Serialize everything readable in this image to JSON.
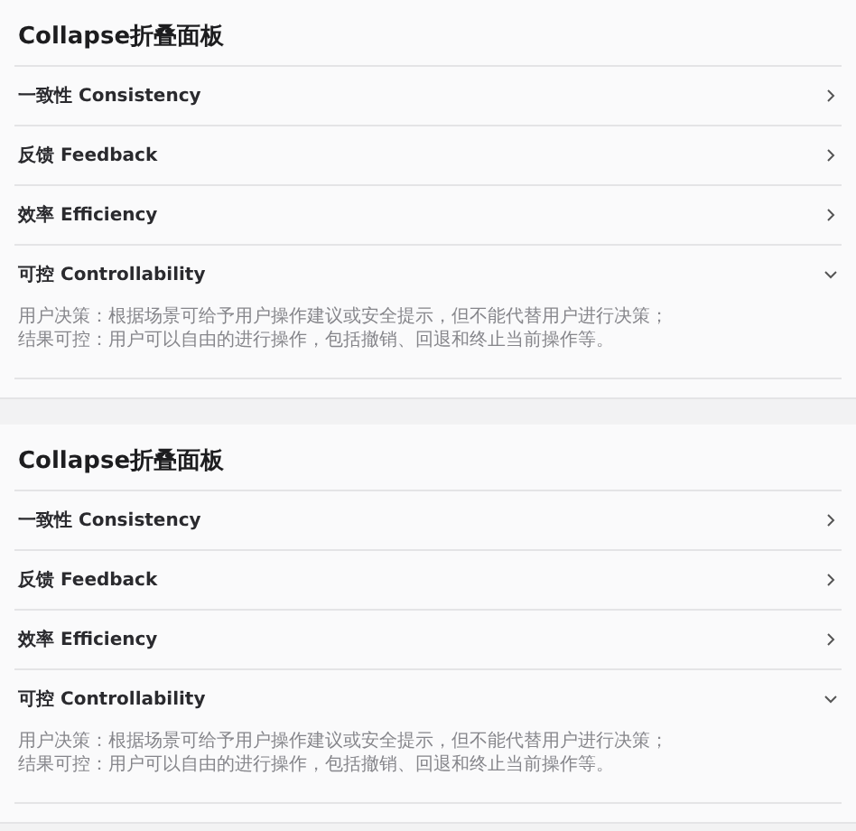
{
  "panels": [
    {
      "title": "Collapse折叠面板",
      "items": [
        {
          "label": "一致性 Consistency",
          "expanded": false
        },
        {
          "label": "反馈 Feedback",
          "expanded": false
        },
        {
          "label": "效率 Efficiency",
          "expanded": false
        },
        {
          "label": "可控 Controllability",
          "expanded": true,
          "content": [
            "用户决策：根据场景可给予用户操作建议或安全提示，但不能代替用户进行决策；",
            "结果可控：用户可以自由的进行操作，包括撤销、回退和终止当前操作等。"
          ]
        }
      ]
    },
    {
      "title": "Collapse折叠面板",
      "items": [
        {
          "label": "一致性 Consistency",
          "expanded": false
        },
        {
          "label": "反馈 Feedback",
          "expanded": false
        },
        {
          "label": "效率 Efficiency",
          "expanded": false
        },
        {
          "label": "可控 Controllability",
          "expanded": true,
          "content": [
            "用户决策：根据场景可给予用户操作建议或安全提示，但不能代替用户进行决策；",
            "结果可控：用户可以自由的进行操作，包括撤销、回退和终止当前操作等。"
          ]
        }
      ]
    }
  ]
}
